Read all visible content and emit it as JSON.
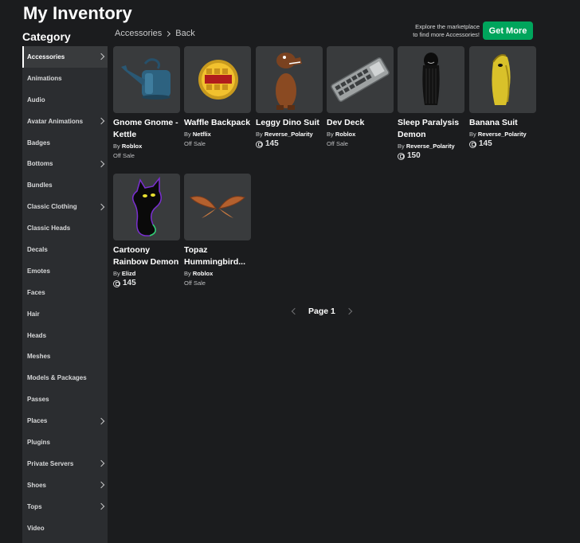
{
  "page": {
    "title": "My Inventory",
    "category_title": "Category"
  },
  "sidebar": {
    "items": [
      {
        "label": "Accessories",
        "chevron": true,
        "active": true
      },
      {
        "label": "Animations",
        "chevron": false
      },
      {
        "label": "Audio",
        "chevron": false
      },
      {
        "label": "Avatar Animations",
        "chevron": true
      },
      {
        "label": "Badges",
        "chevron": false
      },
      {
        "label": "Bottoms",
        "chevron": true
      },
      {
        "label": "Bundles",
        "chevron": false
      },
      {
        "label": "Classic Clothing",
        "chevron": true
      },
      {
        "label": "Classic Heads",
        "chevron": false
      },
      {
        "label": "Decals",
        "chevron": false
      },
      {
        "label": "Emotes",
        "chevron": false
      },
      {
        "label": "Faces",
        "chevron": false
      },
      {
        "label": "Hair",
        "chevron": false
      },
      {
        "label": "Heads",
        "chevron": false
      },
      {
        "label": "Meshes",
        "chevron": false
      },
      {
        "label": "Models & Packages",
        "chevron": false
      },
      {
        "label": "Passes",
        "chevron": false
      },
      {
        "label": "Places",
        "chevron": true
      },
      {
        "label": "Plugins",
        "chevron": false
      },
      {
        "label": "Private Servers",
        "chevron": true
      },
      {
        "label": "Shoes",
        "chevron": true
      },
      {
        "label": "Tops",
        "chevron": true
      },
      {
        "label": "Video",
        "chevron": false
      }
    ]
  },
  "breadcrumb": {
    "current": "Accessories",
    "back": "Back"
  },
  "promo": {
    "line1": "Explore the marketplace",
    "line2": "to find more Accessories!",
    "button": "Get More"
  },
  "items": [
    {
      "name": "Gnome Gnome - Kettle",
      "by": "By",
      "creator": "Roblox",
      "price": "Off Sale",
      "robux": false,
      "icon": "watering-can"
    },
    {
      "name": "Waffle Backpack",
      "by": "By",
      "creator": "Netflix",
      "price": "Off Sale",
      "robux": false,
      "icon": "waffle"
    },
    {
      "name": "Leggy Dino Suit",
      "by": "By",
      "creator": "Reverse_Polarity",
      "price": "145",
      "robux": true,
      "icon": "dino"
    },
    {
      "name": "Dev Deck",
      "by": "By",
      "creator": "Roblox",
      "price": "Off Sale",
      "robux": false,
      "icon": "keyboard"
    },
    {
      "name": "Sleep Paralysis Demon",
      "by": "By",
      "creator": "Reverse_Polarity",
      "price": "150",
      "robux": true,
      "icon": "demon"
    },
    {
      "name": "Banana Suit",
      "by": "By",
      "creator": "Reverse_Polarity",
      "price": "145",
      "robux": true,
      "icon": "banana"
    },
    {
      "name": "Cartoony Rainbow Demon",
      "by": "By",
      "creator": "Elizd",
      "price": "145",
      "robux": true,
      "icon": "rainbow-demon"
    },
    {
      "name": "Topaz Hummingbird...",
      "by": "By",
      "creator": "Roblox",
      "price": "Off Sale",
      "robux": false,
      "icon": "wings"
    }
  ],
  "pagination": {
    "label": "Page 1"
  },
  "colors": {
    "background": "#1b1c1e",
    "sidebar": "#2b2d30",
    "card": "#393b3d",
    "accent": "#00a55c"
  }
}
